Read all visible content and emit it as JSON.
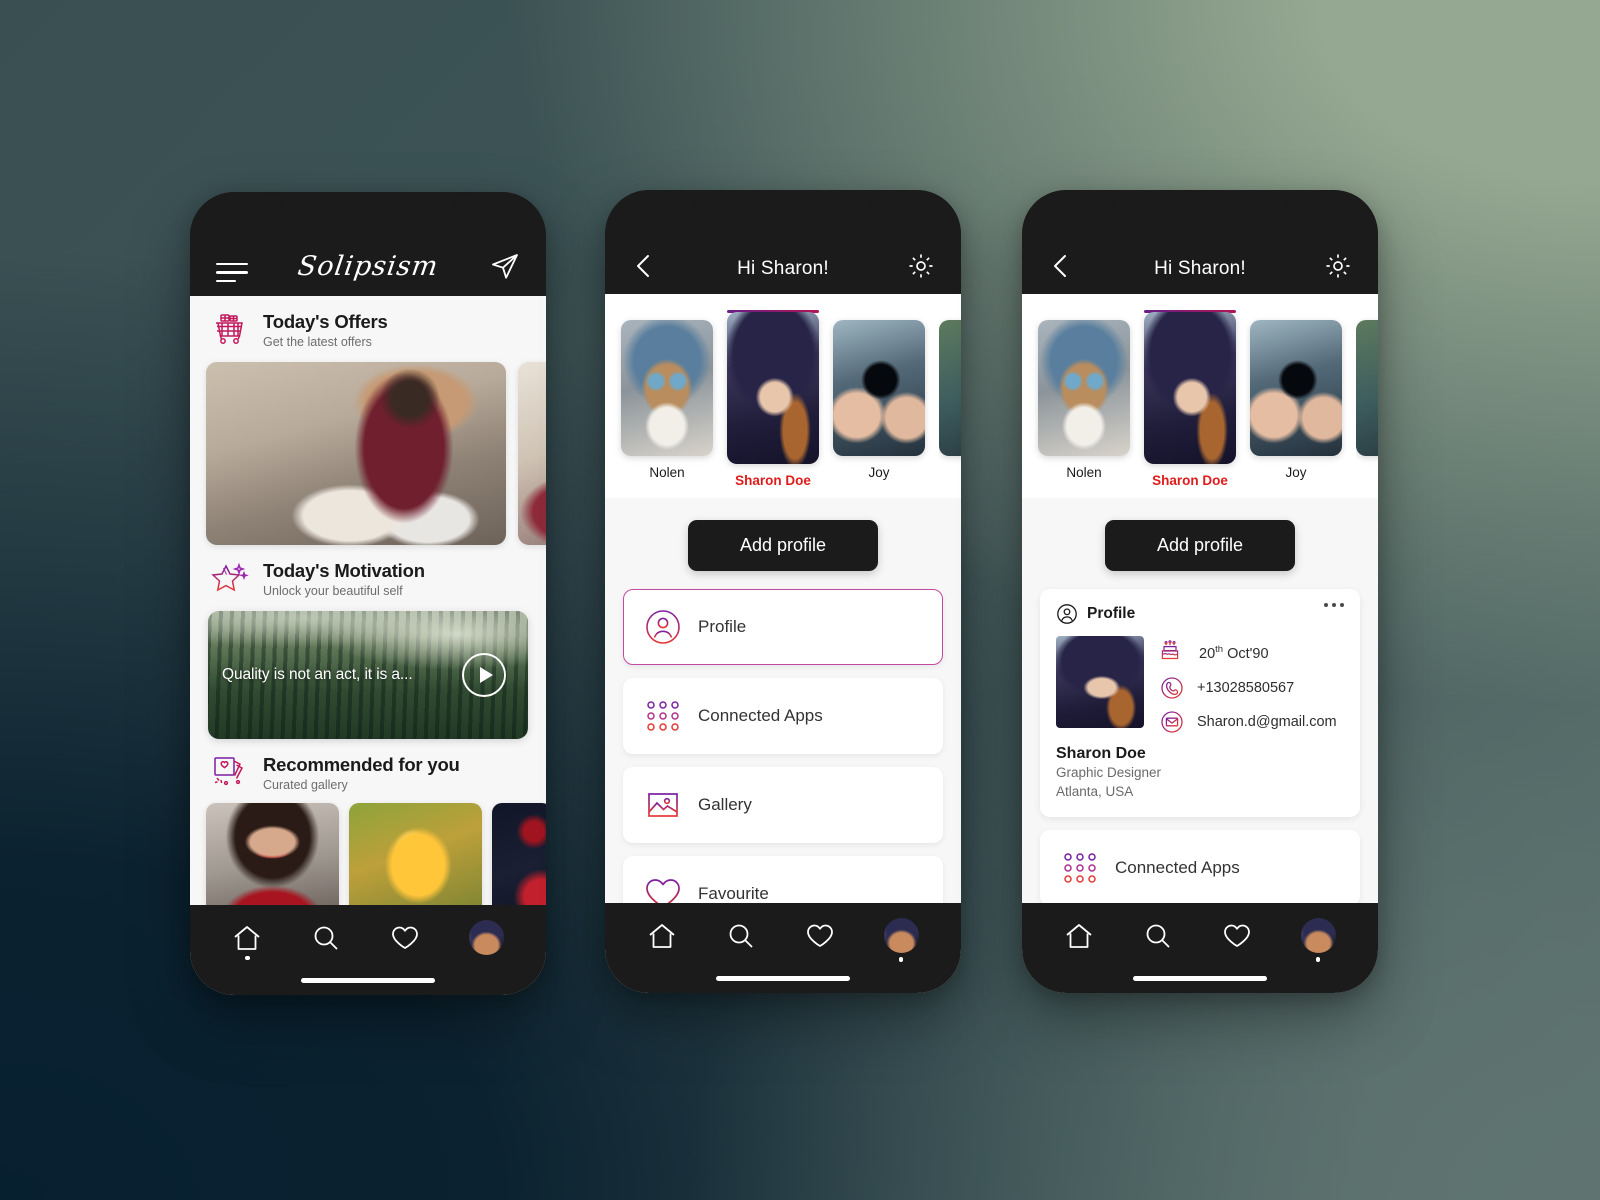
{
  "background": {
    "top_left": "#3a4f52",
    "top_right": "#95a891",
    "bottom_left": "#0b2230",
    "bottom_right": "#5f7470"
  },
  "accent": {
    "pink": "#c44a9e",
    "red": "#e01b1b",
    "purple": "#6b1f8a",
    "magenta": "#b5175a",
    "dark": "#1b1b1b"
  },
  "screen_home": {
    "brand": "Solipsism",
    "icons": {
      "menu": "hamburger-icon",
      "send": "send-icon"
    },
    "sections": [
      {
        "icon": "shopping-cart-gift-icon",
        "title": "Today's Offers",
        "subtitle": "Get the latest offers"
      },
      {
        "icon": "star-sparkle-icon",
        "title": "Today's Motivation",
        "subtitle": "Unlock your beautiful self"
      },
      {
        "icon": "photo-heart-icon",
        "title": "Recommended for you",
        "subtitle": "Curated gallery"
      }
    ],
    "video": {
      "quote": "Quality is not an act, it is a...",
      "play_icon": "play-icon"
    },
    "nav": [
      {
        "icon": "home-icon",
        "active": true
      },
      {
        "icon": "search-icon",
        "active": false
      },
      {
        "icon": "heart-icon",
        "active": false
      },
      {
        "icon": "profile-avatar-icon",
        "active": false
      }
    ]
  },
  "screen_menu": {
    "header": {
      "back_icon": "chevron-left-icon",
      "title": "Hi Sharon!",
      "settings_icon": "gear-icon"
    },
    "stories": [
      {
        "name": "Nolen",
        "active": false
      },
      {
        "name": "Sharon Doe",
        "active": true
      },
      {
        "name": "Joy",
        "active": false
      },
      {
        "name": "",
        "active": false
      }
    ],
    "add_profile_label": "Add profile",
    "menu_items": [
      {
        "icon": "user-circle-icon",
        "label": "Profile",
        "selected": true
      },
      {
        "icon": "apps-grid-icon",
        "label": "Connected Apps",
        "selected": false
      },
      {
        "icon": "gallery-image-icon",
        "label": "Gallery",
        "selected": false
      },
      {
        "icon": "heart-icon",
        "label": "Favourite",
        "selected": false
      }
    ],
    "nav": [
      {
        "icon": "home-icon",
        "active": false
      },
      {
        "icon": "search-icon",
        "active": false
      },
      {
        "icon": "heart-icon",
        "active": false
      },
      {
        "icon": "profile-avatar-icon",
        "active": true
      }
    ]
  },
  "screen_profile": {
    "header": {
      "back_icon": "chevron-left-icon",
      "title": "Hi Sharon!",
      "settings_icon": "gear-icon"
    },
    "stories": [
      {
        "name": "Nolen",
        "active": false
      },
      {
        "name": "Sharon Doe",
        "active": true
      },
      {
        "name": "Joy",
        "active": false
      },
      {
        "name": "",
        "active": false
      }
    ],
    "add_profile_label": "Add profile",
    "profile_card": {
      "header_icon": "user-circle-icon",
      "header_title": "Profile",
      "more_icon": "more-horizontal-icon",
      "name": "Sharon Doe",
      "role": "Graphic Designer",
      "location": "Atlanta, USA",
      "details": [
        {
          "icon": "birthday-cake-icon",
          "value": "20",
          "sup": "th",
          "rest": " Oct'90"
        },
        {
          "icon": "phone-icon",
          "value": "+13028580567"
        },
        {
          "icon": "email-icon",
          "value": "Sharon.d@gmail.com"
        }
      ]
    },
    "menu_items": [
      {
        "icon": "apps-grid-icon",
        "label": "Connected Apps"
      }
    ],
    "nav": [
      {
        "icon": "home-icon",
        "active": false
      },
      {
        "icon": "search-icon",
        "active": false
      },
      {
        "icon": "heart-icon",
        "active": false
      },
      {
        "icon": "profile-avatar-icon",
        "active": true
      }
    ]
  }
}
